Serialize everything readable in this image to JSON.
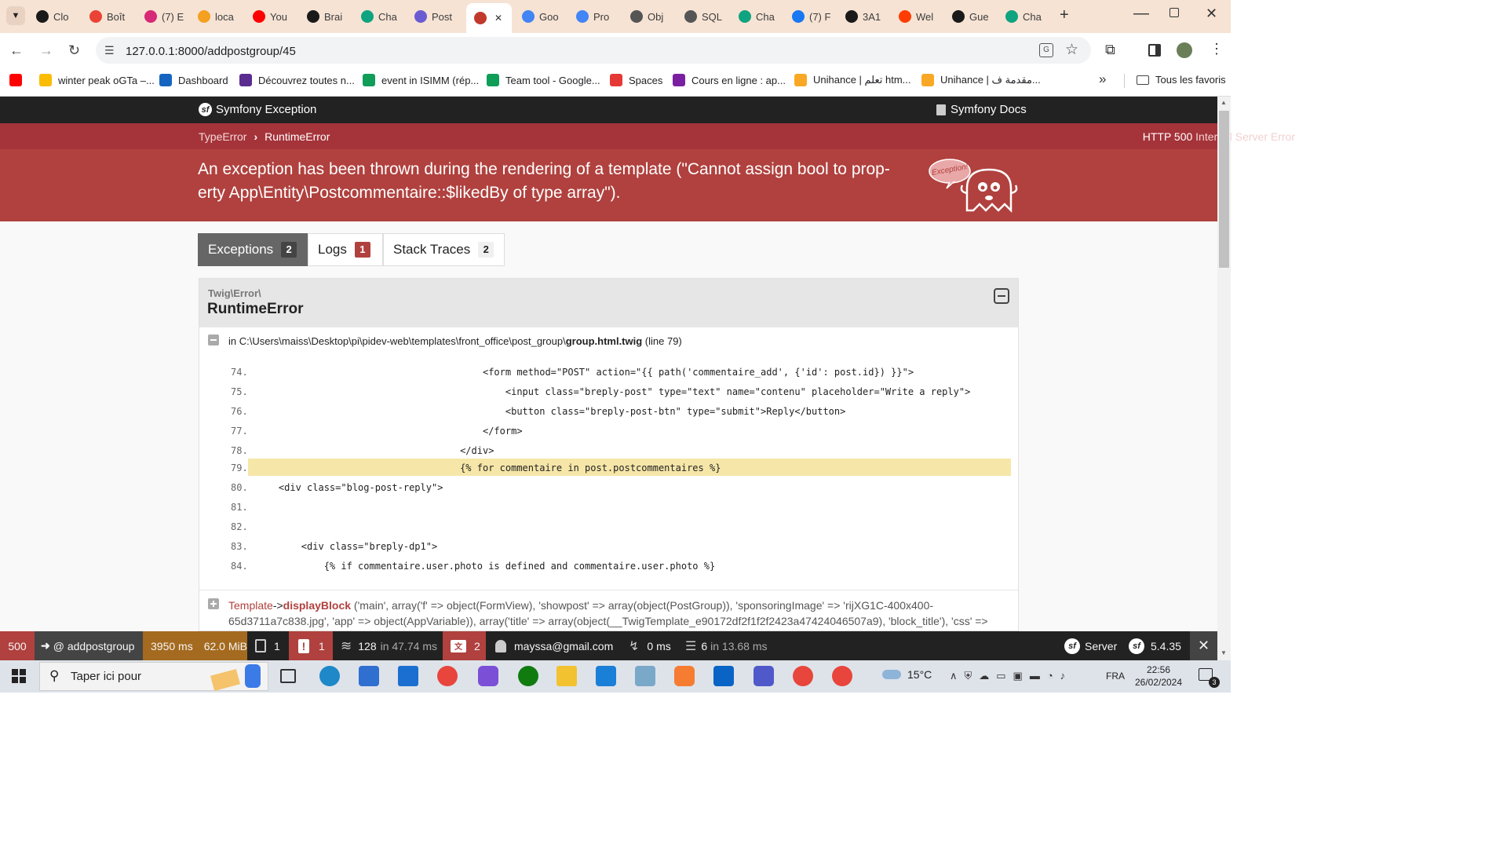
{
  "browser": {
    "tabs": [
      {
        "label": "Clo",
        "color": "#1a1a1a",
        "icon": "leaf-icon"
      },
      {
        "label": "Boît",
        "color": "#ea4335",
        "icon": "gmail-icon"
      },
      {
        "label": "(7) E",
        "color": "#d62976",
        "icon": "instagram-icon"
      },
      {
        "label": "loca",
        "color": "#f4a020",
        "icon": "xampp-icon"
      },
      {
        "label": "You",
        "color": "#ff0000",
        "icon": "youtube-icon"
      },
      {
        "label": "Brai",
        "color": "#1a1a1a",
        "icon": "github-icon"
      },
      {
        "label": "Cha",
        "color": "#10a37f",
        "icon": "chatgpt-icon"
      },
      {
        "label": "Post",
        "color": "#6b5bd2",
        "icon": "postman-icon"
      },
      {
        "label": "",
        "color": "#c0392b",
        "icon": "symfony-ghost-icon"
      },
      {
        "label": "Goo",
        "color": "#4285f4",
        "icon": "google-translate-icon"
      },
      {
        "label": "Pro",
        "color": "#4285f4",
        "icon": "google-icon"
      },
      {
        "label": "Obj",
        "color": "#555555",
        "icon": "globe-icon"
      },
      {
        "label": "SQL",
        "color": "#555555",
        "icon": "globe-icon"
      },
      {
        "label": "Cha",
        "color": "#10a37f",
        "icon": "chatgpt-icon"
      },
      {
        "label": "(7) F",
        "color": "#1877f2",
        "icon": "facebook-icon"
      },
      {
        "label": "3A1",
        "color": "#1a1a1a",
        "icon": "github-icon"
      },
      {
        "label": "Wel",
        "color": "#ff3d00",
        "icon": "opera-icon"
      },
      {
        "label": "Gue",
        "color": "#1a1a1a",
        "icon": "github-icon"
      },
      {
        "label": "Cha",
        "color": "#10a37f",
        "icon": "chatgpt-icon"
      }
    ],
    "new_tab": "+",
    "url": "127.0.0.1:8000/addpostgroup/45",
    "bookmarks": [
      {
        "label": "",
        "color": "#ff0000",
        "icon": "youtube-icon"
      },
      {
        "label": "winter peak oGTa –...",
        "color": "#fbbc04",
        "icon": "drive-icon"
      },
      {
        "label": "Dashboard",
        "color": "#1565c0",
        "icon": "dashboard-icon"
      },
      {
        "label": "Découvrez toutes n...",
        "color": "#5b2c8f",
        "icon": "bookmark-icon"
      },
      {
        "label": "event in ISIMM (rép...",
        "color": "#0f9d58",
        "icon": "sheets-icon"
      },
      {
        "label": "Team tool - Google...",
        "color": "#0f9d58",
        "icon": "sheets-icon"
      },
      {
        "label": "Spaces",
        "color": "#e53935",
        "icon": "spaces-icon"
      },
      {
        "label": "Cours en ligne  : ap...",
        "color": "#7b1fa2",
        "icon": "gear-icon"
      },
      {
        "label": "Unihance | تعلم htm...",
        "color": "#f9a825",
        "icon": "unihance-icon"
      },
      {
        "label": "Unihance | مقدمة ف...",
        "color": "#f9a825",
        "icon": "unihance-icon"
      }
    ],
    "bookmarks_more": "»",
    "all_bookmarks": "Tous les favoris"
  },
  "symfony": {
    "brand": "Symfony Exception",
    "docs": "Symfony Docs",
    "breadcrumb": [
      "TypeError",
      "RuntimeError"
    ],
    "http_code": "HTTP 500",
    "http_text": "Internal Server Error",
    "message": "An exception has been thrown during the rendering of a template (\"Cannot assign bool to prop-erty App\\Entity\\Postcommentaire::$likedBy of type array\").",
    "ghost_text": "Exception!",
    "tabs": [
      {
        "label": "Exceptions",
        "count": "2"
      },
      {
        "label": "Logs",
        "count": "1"
      },
      {
        "label": "Stack Traces",
        "count": "2"
      }
    ],
    "exception": {
      "namespace": "Twig\\Error\\",
      "class": "RuntimeError",
      "location_prefix": "in C:\\Users\\maiss\\Desktop\\pi\\pidev-web\\templates\\front_office\\post_group\\",
      "location_file": "group.html.twig",
      "location_line": "(line 79)",
      "lines": [
        {
          "num": "74.",
          "code": "                                        <form method=\"POST\" action=\"{{ path('commentaire_add', {'id': post.id}) }}\">"
        },
        {
          "num": "75.",
          "code": "                                            <input class=\"breply-post\" type=\"text\" name=\"contenu\" placeholder=\"Write a reply\">"
        },
        {
          "num": "76.",
          "code": "                                            <button class=\"breply-post-btn\" type=\"submit\">Reply</button>"
        },
        {
          "num": "77.",
          "code": "                                        </form>"
        },
        {
          "num": "78.",
          "code": "                                    </div>"
        },
        {
          "num": "79.",
          "code": "                                    {% for commentaire in post.postcommentaires %}"
        },
        {
          "num": "80.",
          "code": "    <div class=\"blog-post-reply\">"
        },
        {
          "num": "81.",
          "code": ""
        },
        {
          "num": "82.",
          "code": ""
        },
        {
          "num": "83.",
          "code": "        <div class=\"breply-dp1\">"
        },
        {
          "num": "84.",
          "code": "            {% if commentaire.user.photo is defined and commentaire.user.photo %}"
        }
      ],
      "trace_class": "Template",
      "trace_arrow": "->",
      "trace_method": "displayBlock",
      "trace_args_1": "('main', array('f' => object(FormView), 'showpost' => array(object(PostGroup)), 'sponsoringImage' => 'rijXG1C-400x400-",
      "trace_args_2": "65d3711a7c838.jpg', 'app' => object(AppVariable)), array('title' => array(object(__TwigTemplate_e90172df2f1f2f2423a47424046507a9), 'block_title'), 'css' =>"
    }
  },
  "debug_toolbar": {
    "status": "500",
    "route": "@ addpostgroup",
    "time": "3950 ms",
    "memory": "62.0 MiB",
    "forms": "1",
    "logs": "1",
    "cache_count": "128",
    "cache_time": "in 47.74 ms",
    "translation": "2",
    "user": "mayssa@gmail.com",
    "events_time": "0 ms",
    "db_count": "6",
    "db_time": "in 13.68 ms",
    "server": "Server",
    "version": "5.4.35",
    "close": "✕"
  },
  "taskbar": {
    "search_placeholder": "Taper ici pour",
    "weather": "15°C",
    "lang": "FRA",
    "time": "22:56",
    "date": "26/02/2024",
    "notifications": "3"
  }
}
